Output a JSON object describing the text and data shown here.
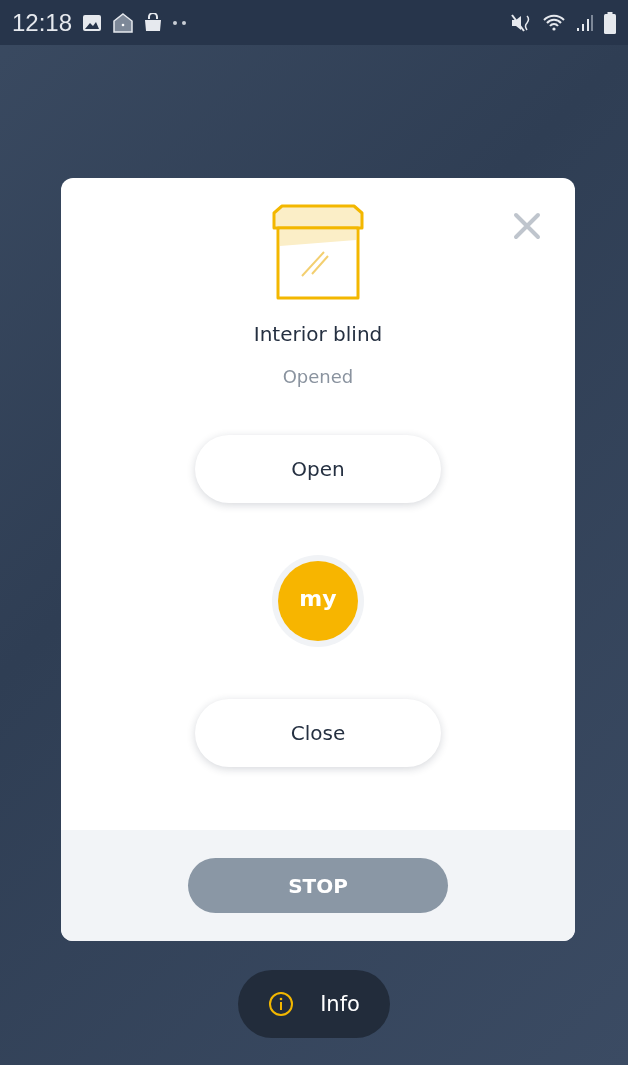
{
  "status_bar": {
    "time": "12:18"
  },
  "dialog": {
    "device_name": "Interior blind",
    "state": "Opened",
    "controls": [
      {
        "kind": "pill",
        "label": "Open"
      },
      {
        "kind": "circle",
        "label": "my"
      },
      {
        "kind": "pill",
        "label": "Close"
      }
    ],
    "footer_button": "STOP"
  },
  "info_button": "Info"
}
